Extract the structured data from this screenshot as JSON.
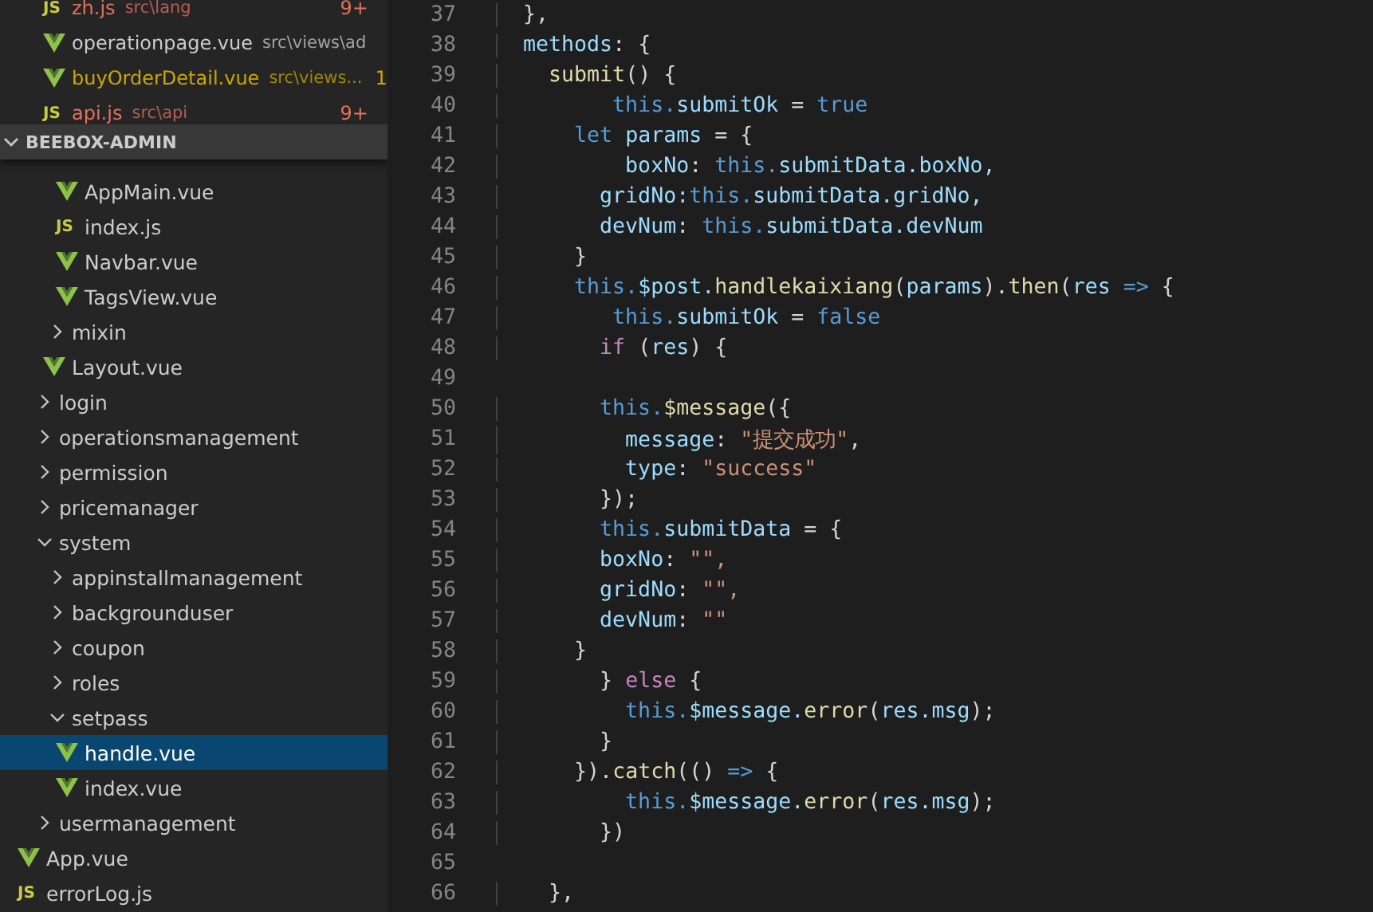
{
  "open_editors": [
    {
      "label": "zh.js",
      "icon_text": "JS",
      "kind": "js",
      "path": "src\\lang",
      "badge": "9+",
      "color": "#e2725b"
    },
    {
      "label": "operationpage.vue",
      "kind": "vue",
      "path": "src\\views\\ad",
      "color": "#cccccc"
    },
    {
      "label": "buyOrderDetail.vue",
      "kind": "vue",
      "path": "src\\views...",
      "badge": "1",
      "color": "#cca700"
    },
    {
      "label": "api.js",
      "icon_text": "JS",
      "kind": "js",
      "path": "src\\api",
      "badge": "9+",
      "color": "#e2725b"
    }
  ],
  "explorer": {
    "title": "BEEBOX-ADMIN",
    "expanded": true,
    "tree": [
      {
        "children": [
          {
            "children": [
              {
                "children": [
                  {
                    "label": "AppMain.vue",
                    "kind": "vue",
                    "selected": false
                  },
                  {
                    "label": "index.js",
                    "kind": "js",
                    "icon_text": "JS",
                    "selected": false
                  },
                  {
                    "label": "Navbar.vue",
                    "kind": "vue",
                    "selected": false
                  },
                  {
                    "label": "TagsView.vue",
                    "kind": "vue",
                    "selected": false
                  }
                ]
              },
              {
                "label": "mixin",
                "kind": "folder",
                "expanded": false,
                "selected": false
              },
              {
                "label": "Layout.vue",
                "kind": "vue",
                "selected": false
              }
            ]
          },
          {
            "label": "login",
            "kind": "folder",
            "expanded": false,
            "selected": false
          },
          {
            "label": "operationsmanagement",
            "kind": "folder",
            "expanded": false,
            "selected": false
          },
          {
            "label": "permission",
            "kind": "folder",
            "expanded": false,
            "selected": false
          },
          {
            "label": "pricemanager",
            "kind": "folder",
            "expanded": false,
            "selected": false
          },
          {
            "label": "system",
            "kind": "folder",
            "expanded": true,
            "selected": false,
            "children": [
              {
                "label": "appinstallmanagement",
                "kind": "folder",
                "expanded": false,
                "selected": false
              },
              {
                "label": "backgrounduser",
                "kind": "folder",
                "expanded": false,
                "selected": false
              },
              {
                "label": "coupon",
                "kind": "folder",
                "expanded": false,
                "selected": false
              },
              {
                "label": "roles",
                "kind": "folder",
                "expanded": false,
                "selected": false
              },
              {
                "label": "setpass",
                "kind": "folder",
                "expanded": true,
                "selected": false,
                "children": [
                  {
                    "label": "handle.vue",
                    "kind": "vue",
                    "selected": true
                  },
                  {
                    "label": "index.vue",
                    "kind": "vue",
                    "selected": false
                  }
                ]
              }
            ]
          },
          {
            "label": "usermanagement",
            "kind": "folder",
            "expanded": false,
            "selected": false
          }
        ]
      },
      {
        "label": "App.vue",
        "kind": "vue",
        "selected": false
      },
      {
        "label": "errorLog.js",
        "kind": "js",
        "icon_text": "JS",
        "selected": false
      }
    ]
  },
  "editor": {
    "lines": [
      {
        "number": "37",
        "tokens": [
          {
            "text": "  },",
            "kind": "p"
          }
        ]
      },
      {
        "number": "38",
        "tokens": [
          {
            "text": "  methods",
            "kind": "v"
          },
          {
            "text": ": {",
            "kind": "p"
          }
        ]
      },
      {
        "number": "39",
        "tokens": [
          {
            "text": "    submit",
            "kind": "f"
          },
          {
            "text": "() {",
            "kind": "p"
          }
        ]
      },
      {
        "number": "40",
        "tokens": [
          {
            "text": "         this.",
            "kind": "k"
          },
          {
            "text": "submitOk",
            "kind": "v"
          },
          {
            "text": " = ",
            "kind": "p"
          },
          {
            "text": "true",
            "kind": "k"
          }
        ]
      },
      {
        "number": "41",
        "tokens": [
          {
            "text": "      let",
            "kind": "k"
          },
          {
            "text": " params",
            "kind": "v"
          },
          {
            "text": " = {",
            "kind": "p"
          }
        ]
      },
      {
        "number": "42",
        "tokens": [
          {
            "text": "          boxNo",
            "kind": "v"
          },
          {
            "text": ": ",
            "kind": "p"
          },
          {
            "text": "this.",
            "kind": "k"
          },
          {
            "text": "submitData.boxNo,",
            "kind": "v"
          }
        ]
      },
      {
        "number": "43",
        "tokens": [
          {
            "text": "        gridNo:",
            "kind": "v"
          },
          {
            "text": "this.",
            "kind": "k"
          },
          {
            "text": "submitData.gridNo,",
            "kind": "v"
          }
        ]
      },
      {
        "number": "44",
        "tokens": [
          {
            "text": "        devNum",
            "kind": "v"
          },
          {
            "text": ": ",
            "kind": "p"
          },
          {
            "text": "this.",
            "kind": "k"
          },
          {
            "text": "submitData.devNum",
            "kind": "v"
          }
        ]
      },
      {
        "number": "45",
        "tokens": [
          {
            "text": "      }",
            "kind": "p"
          }
        ]
      },
      {
        "number": "46",
        "tokens": [
          {
            "text": "      this.",
            "kind": "k"
          },
          {
            "text": "$post.",
            "kind": "v"
          },
          {
            "text": "handlekaixiang",
            "kind": "f"
          },
          {
            "text": "(",
            "kind": "p"
          },
          {
            "text": "params",
            "kind": "v"
          },
          {
            "text": ").",
            "kind": "p"
          },
          {
            "text": "then",
            "kind": "f"
          },
          {
            "text": "(",
            "kind": "p"
          },
          {
            "text": "res",
            "kind": "v"
          },
          {
            "text": " =>",
            "kind": "k"
          },
          {
            "text": " {",
            "kind": "p"
          }
        ]
      },
      {
        "number": "47",
        "tokens": [
          {
            "text": "         this.",
            "kind": "k"
          },
          {
            "text": "submitOk",
            "kind": "v"
          },
          {
            "text": " = ",
            "kind": "p"
          },
          {
            "text": "false",
            "kind": "k"
          }
        ]
      },
      {
        "number": "48",
        "tokens": [
          {
            "text": "        if",
            "kind": "c"
          },
          {
            "text": " (",
            "kind": "p"
          },
          {
            "text": "res",
            "kind": "v"
          },
          {
            "text": ") {",
            "kind": "p"
          }
        ]
      },
      {
        "number": "49"
      },
      {
        "number": "50",
        "tokens": [
          {
            "text": "        this.",
            "kind": "k"
          },
          {
            "text": "$message",
            "kind": "f"
          },
          {
            "text": "({",
            "kind": "p"
          }
        ]
      },
      {
        "number": "51",
        "tokens": [
          {
            "text": "          message",
            "kind": "v"
          },
          {
            "text": ": ",
            "kind": "p"
          },
          {
            "text": "\"提交成功\"",
            "kind": "s"
          },
          {
            "text": ",",
            "kind": "p"
          }
        ]
      },
      {
        "number": "52",
        "tokens": [
          {
            "text": "          type",
            "kind": "v"
          },
          {
            "text": ": ",
            "kind": "p"
          },
          {
            "text": "\"success\"",
            "kind": "s"
          }
        ]
      },
      {
        "number": "53",
        "tokens": [
          {
            "text": "        });",
            "kind": "p"
          }
        ]
      },
      {
        "number": "54",
        "tokens": [
          {
            "text": "        this.",
            "kind": "k"
          },
          {
            "text": "submitData",
            "kind": "v"
          },
          {
            "text": " = {",
            "kind": "p"
          }
        ]
      },
      {
        "number": "55",
        "tokens": [
          {
            "text": "        boxNo",
            "kind": "v"
          },
          {
            "text": ": ",
            "kind": "p"
          },
          {
            "text": "\"\",",
            "kind": "s"
          }
        ]
      },
      {
        "number": "56",
        "tokens": [
          {
            "text": "        gridNo",
            "kind": "v"
          },
          {
            "text": ": ",
            "kind": "p"
          },
          {
            "text": "\"\",",
            "kind": "s"
          }
        ]
      },
      {
        "number": "57",
        "tokens": [
          {
            "text": "        devNum",
            "kind": "v"
          },
          {
            "text": ": ",
            "kind": "p"
          },
          {
            "text": "\"\"",
            "kind": "s"
          }
        ]
      },
      {
        "number": "58",
        "tokens": [
          {
            "text": "      }",
            "kind": "p"
          }
        ]
      },
      {
        "number": "59",
        "tokens": [
          {
            "text": "        } ",
            "kind": "p"
          },
          {
            "text": "else",
            "kind": "c"
          },
          {
            "text": " {",
            "kind": "p"
          }
        ]
      },
      {
        "number": "60",
        "tokens": [
          {
            "text": "          this.",
            "kind": "k"
          },
          {
            "text": "$message.",
            "kind": "v"
          },
          {
            "text": "error",
            "kind": "f"
          },
          {
            "text": "(",
            "kind": "p"
          },
          {
            "text": "res.msg",
            "kind": "v"
          },
          {
            "text": ");",
            "kind": "p"
          }
        ]
      },
      {
        "number": "61",
        "tokens": [
          {
            "text": "        }",
            "kind": "p"
          }
        ]
      },
      {
        "number": "62",
        "tokens": [
          {
            "text": "      }).",
            "kind": "p"
          },
          {
            "text": "catch",
            "kind": "f"
          },
          {
            "text": "(() ",
            "kind": "p"
          },
          {
            "text": "=>",
            "kind": "k"
          },
          {
            "text": " {",
            "kind": "p"
          }
        ]
      },
      {
        "number": "63",
        "tokens": [
          {
            "text": "          this.",
            "kind": "k"
          },
          {
            "text": "$message.",
            "kind": "v"
          },
          {
            "text": "error",
            "kind": "f"
          },
          {
            "text": "(",
            "kind": "p"
          },
          {
            "text": "res.msg",
            "kind": "v"
          },
          {
            "text": ");",
            "kind": "p"
          }
        ]
      },
      {
        "number": "64",
        "tokens": [
          {
            "text": "        })",
            "kind": "p"
          }
        ]
      },
      {
        "number": "65"
      },
      {
        "number": "66",
        "tokens": [
          {
            "text": "    },",
            "kind": "p"
          }
        ]
      }
    ]
  }
}
